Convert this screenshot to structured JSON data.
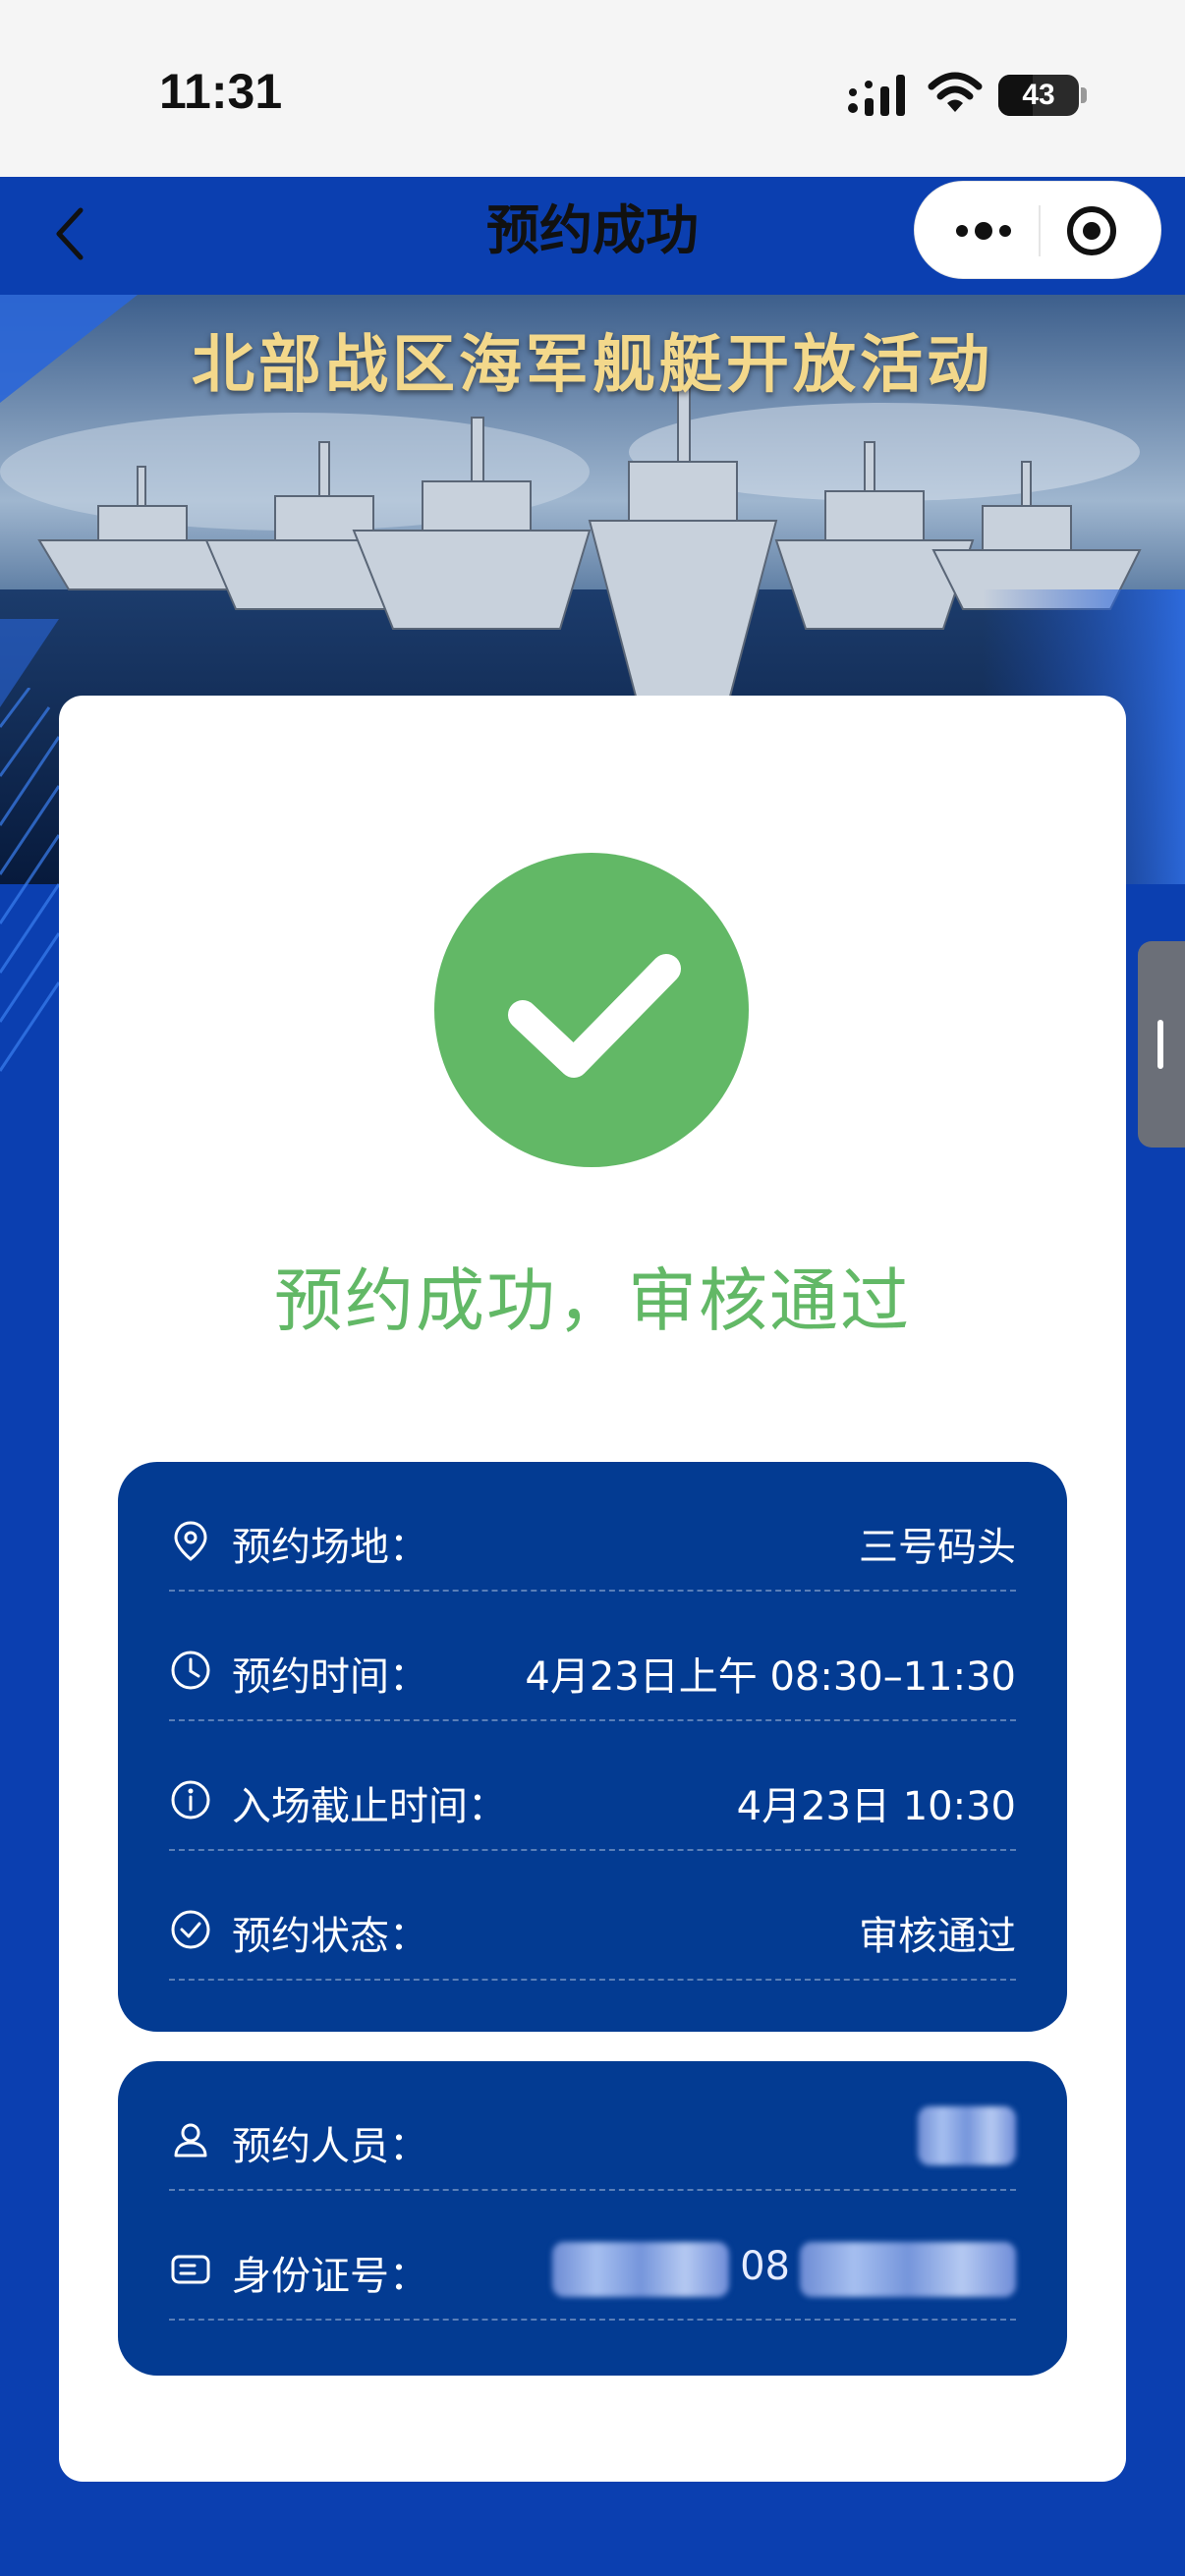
{
  "status_bar": {
    "time": "11:31",
    "battery": "43",
    "battery_level": 0.43,
    "icons": [
      "signal-icon",
      "wifi-icon",
      "battery-icon"
    ]
  },
  "nav": {
    "title": "预约成功",
    "icons": [
      "chevron-left-icon",
      "more-icon",
      "record-icon"
    ]
  },
  "banner": {
    "title": "北部战区海军舰艇开放活动"
  },
  "result": {
    "message": "预约成功，审核通过",
    "accent": "#62b866"
  },
  "details": [
    {
      "icon": "location-pin-icon",
      "label": "预约场地：",
      "value": "三号码头"
    },
    {
      "icon": "clock-icon",
      "label": "预约时间：",
      "value": "4月23日上午 08:30–11:30"
    },
    {
      "icon": "info-icon",
      "label": "入场截止时间：",
      "value": "4月23日 10:30"
    },
    {
      "icon": "check-circle-icon",
      "label": "预约状态：",
      "value": "审核通过"
    }
  ],
  "person": [
    {
      "icon": "user-icon",
      "label": "预约人员：",
      "value": ""
    },
    {
      "icon": "id-card-icon",
      "label": "身份证号：",
      "value": "08"
    }
  ],
  "colors": {
    "background": "#0b3fb0",
    "panel": "#033b92",
    "card": "#ffffff"
  }
}
